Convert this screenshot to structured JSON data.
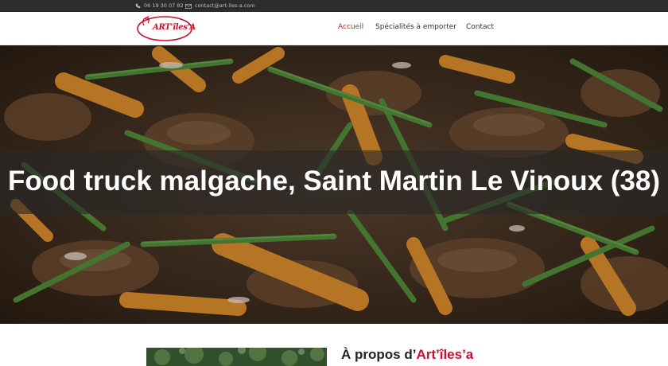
{
  "topbar": {
    "phone": "06 19 30 07 82",
    "email": "contact@art-iles-a.com",
    "phone_icon": "phone-icon",
    "email_icon": "envelope-icon"
  },
  "header": {
    "logo_text": "ART'îles'A",
    "nav": [
      {
        "label": "Accueil",
        "active": true
      },
      {
        "label": "Spécialités à emporter",
        "active": false
      },
      {
        "label": "Contact",
        "active": false
      }
    ]
  },
  "hero": {
    "title": "Food truck malgache, Saint Martin Le Vinoux (38)"
  },
  "about": {
    "prefix": "À propos d’",
    "brand": "Art’îles’a"
  },
  "colors": {
    "accent": "#d2232a",
    "topbar": "#2c2c2c"
  }
}
